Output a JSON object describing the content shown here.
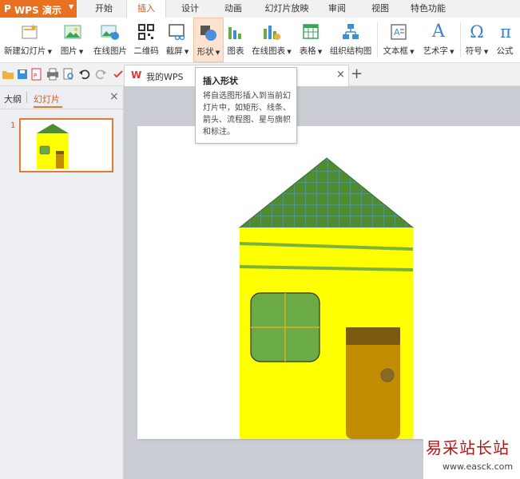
{
  "app": {
    "name": "WPS 演示"
  },
  "tabs": [
    "开始",
    "插入",
    "设计",
    "动画",
    "幻灯片放映",
    "审阅",
    "视图",
    "特色功能"
  ],
  "active_tab": "插入",
  "ribbon": {
    "new_slide": "新建幻灯片",
    "picture": "图片",
    "online_picture": "在线图片",
    "qrcode": "二维码",
    "screenshot": "截屏",
    "shape": "形状",
    "chart": "图表",
    "online_chart": "在线图表",
    "table": "表格",
    "org_chart": "组织结构图",
    "textbox": "文本框",
    "wordart": "艺术字",
    "symbol": "符号",
    "formula": "公式",
    "symbol_glyph": "Ω",
    "formula_glyph": "π",
    "wordart_glyph": "A"
  },
  "doc_tab": {
    "label": "我的WPS",
    "logo": "W"
  },
  "tooltip": {
    "title": "插入形状",
    "description": "将自选图形插入到当前幻灯片中，如矩形、线条、箭头、流程图、星与旗帜和标注。"
  },
  "panel": {
    "outline_tab": "大纲",
    "slides_tab": "幻灯片",
    "slide_number": "1"
  },
  "watermark": {
    "line1": "易采站长站",
    "line2": "www.easck.com"
  },
  "colors": {
    "accent": "#e8701f",
    "wall": "#ffff00",
    "roof": "#4f8b2f",
    "window": "#6aab45",
    "door": "#c18c00",
    "door_top": "#7a5a10"
  }
}
